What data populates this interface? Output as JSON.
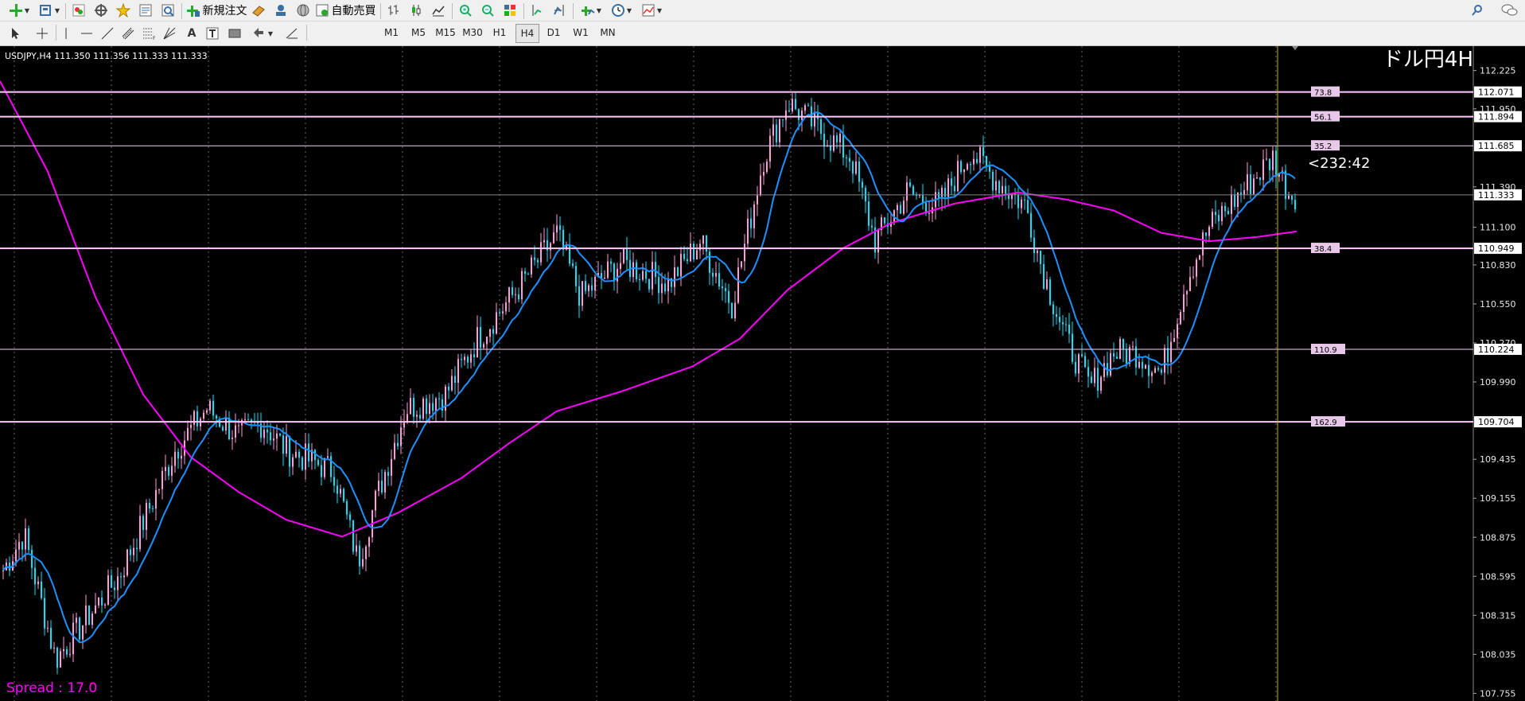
{
  "toolbar": {
    "new_order_label": "新規注文",
    "auto_trade_label": "自動売買",
    "timeframes": [
      "M1",
      "M5",
      "M15",
      "M30",
      "H1",
      "H4",
      "D1",
      "W1",
      "MN"
    ],
    "active_timeframe": "H4",
    "icons": [
      "new-chart-icon",
      "profiles-icon",
      "market-watch-icon",
      "navigator-icon",
      "favorites-icon",
      "strategy-tester-icon",
      "meta-editor-icon",
      "options-icon",
      "signals-icon",
      "bar-chart-icon",
      "candle-chart-icon",
      "line-chart-icon",
      "zoom-in-icon",
      "zoom-out-icon",
      "tile-windows-icon",
      "autoscroll-icon",
      "chart-shift-icon",
      "indicators-icon",
      "period-clock-icon",
      "templates-icon",
      "search-icon",
      "chat-icon",
      "cursor-icon",
      "crosshair-icon",
      "vertical-line-icon",
      "horizontal-line-icon",
      "trendline-icon",
      "channel-icon",
      "fibonacci-icon",
      "gann-icon",
      "text-icon",
      "text-label-icon",
      "rectangle-icon",
      "arrows-icon",
      "line-studies-icon"
    ],
    "text_tool_label": "A"
  },
  "chart": {
    "info_text": "USDJPY,H4  111.350 111.356 111.333 111.333",
    "title": "ドル円4H",
    "countdown": "<232:42",
    "spread_text": "Spread : 17.0",
    "colors": {
      "background": "#000000",
      "bull_candle": "#ff9cd9",
      "bear_candle": "#00e5ff",
      "ma_short": "#1e90ff",
      "ma_long": "#ff00ff",
      "level_line": "#ffc8ff",
      "price_tag_bg": "#ffffff"
    },
    "price_axis": {
      "labels": [
        "112.225",
        "111.950",
        "111.390",
        "111.100",
        "110.830",
        "110.550",
        "110.270",
        "109.990",
        "109.435",
        "109.155",
        "108.875",
        "108.595",
        "108.315",
        "108.035",
        "107.755"
      ],
      "range": [
        107.7,
        112.4
      ]
    },
    "levels": [
      {
        "price": 112.071,
        "label": "73.8",
        "thick": true
      },
      {
        "price": 111.894,
        "label": "56.1",
        "thick": true
      },
      {
        "price": 111.685,
        "label": "35.2",
        "thick": false
      },
      {
        "price": 110.949,
        "label": "38.4",
        "thick": true
      },
      {
        "price": 110.224,
        "label": "110.9",
        "thick": false
      },
      {
        "price": 109.704,
        "label": "162.9",
        "thick": true
      }
    ],
    "current_price": "111.333",
    "current_price_value": 111.333,
    "vertical_gridlines": 14
  }
}
